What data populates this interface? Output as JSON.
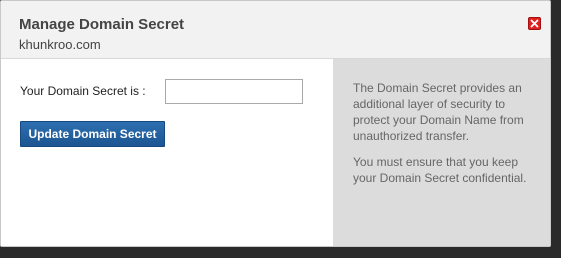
{
  "dialog": {
    "title": "Manage Domain Secret",
    "domain": "khunkroo.com",
    "close_icon": "close-icon",
    "close_color": "#e02020"
  },
  "form": {
    "label": "Your Domain Secret is :",
    "input_value": "",
    "input_placeholder": "",
    "button_label": "Update Domain Secret",
    "button_color": "#1f5b98"
  },
  "info": {
    "paragraph1": "The Domain Secret provides an additional layer of security to protect your Domain Name from unauthorized transfer.",
    "paragraph2": "You must ensure that you keep your Domain Secret confidential."
  }
}
